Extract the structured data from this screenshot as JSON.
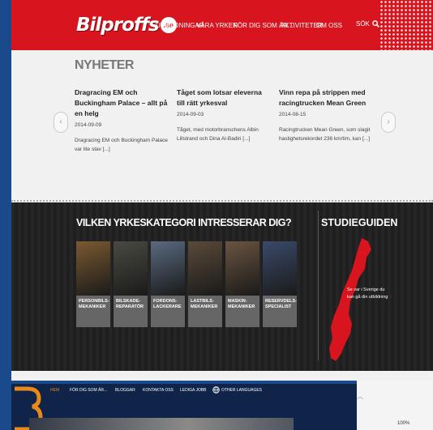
{
  "header": {
    "logo_text": "Bilproffs",
    "logo_suffix": ".se",
    "nav": [
      "UTBILDNINGAR",
      "VÅRA YRKEN",
      "FÖR DIG SOM ÄR ...",
      "AKTIVITETER",
      "OM OSS"
    ],
    "search_label": "SÖK"
  },
  "news": {
    "heading": "NYHETER",
    "items": [
      {
        "title": "Dragracing EM och Buckingham Palace – allt på en helg",
        "date": "2014-09-09",
        "excerpt": "Dragracing EM och Buckingham Palace var lite stav [...]"
      },
      {
        "title": "Tåget som lotsar eleverna till rätt yrkesval",
        "date": "2014-09-03",
        "excerpt": "Tåget, med motorbranschens Albin Lillstrand och Dina Al-Badiri [...]"
      },
      {
        "title": "Vinn repa på strippen med racingtrucken Mean Green",
        "date": "2014-08-15",
        "excerpt": "Racingtrucken Mean Green, som slagit hastighetsrekordet 236 km/tim, kan [...]"
      }
    ]
  },
  "categories": {
    "heading": "VILKEN YRKESKATEGORI INTRESSERAR DIG?",
    "tiles": [
      {
        "label": "PERSONBILS-MEKANIKER",
        "color": "#7a5a30"
      },
      {
        "label": "BILSKADE-REPARATÖR",
        "color": "#4a4a42"
      },
      {
        "label": "FORDONS-LACKERARE",
        "color": "#5a6a80"
      },
      {
        "label": "LASTBILS-MEKANIKER",
        "color": "#5a4a3a"
      },
      {
        "label": "MASKIN-MEKANIKER",
        "color": "#6a5440"
      },
      {
        "label": "RESERVDELS-SPECIALIST",
        "color": "#3a4a6a"
      }
    ]
  },
  "studieguiden": {
    "heading": "STUDIEGUIDEN",
    "text": "Se var i Sverige du kan gå din utbildning"
  },
  "bottom_window": {
    "nav": [
      "HEM",
      "FÖR DIG SOM ÄR...",
      "BLOGGAR",
      "KONTAKTA OSS",
      "LEDIGA JOBB",
      "OTHER LANGUAGES"
    ],
    "zoom": "100%"
  },
  "colors": {
    "brand_red": "#d8141e",
    "dark_bg": "#222222",
    "page_bg": "#f1f1f1",
    "desktop_blue": "#1b4a8c"
  }
}
